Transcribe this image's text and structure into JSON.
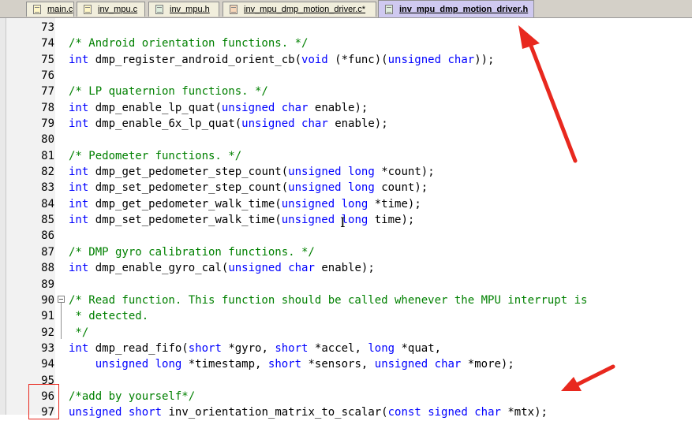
{
  "tabs": [
    {
      "label": "main.c",
      "icon": "c-file-icon",
      "active": false
    },
    {
      "label": "inv_mpu.c",
      "icon": "c-file-icon",
      "active": false
    },
    {
      "label": "inv_mpu.h",
      "icon": "h-file-icon",
      "active": false
    },
    {
      "label": "inv_mpu_dmp_motion_driver.c*",
      "icon": "c-file-modified-icon",
      "active": false
    },
    {
      "label": "inv_mpu_dmp_motion_driver.h",
      "icon": "h-file-icon",
      "active": true
    }
  ],
  "code_lines": [
    {
      "n": "73",
      "segs": []
    },
    {
      "n": "74",
      "segs": [
        {
          "t": "/* Android orientation functions. */",
          "c": "cm"
        }
      ]
    },
    {
      "n": "75",
      "segs": [
        {
          "t": "int",
          "c": "kw"
        },
        {
          "t": " dmp_register_android_orient_cb(",
          "c": ""
        },
        {
          "t": "void",
          "c": "kw"
        },
        {
          "t": " (*func)(",
          "c": ""
        },
        {
          "t": "unsigned",
          "c": "kw"
        },
        {
          "t": " ",
          "c": ""
        },
        {
          "t": "char",
          "c": "kw"
        },
        {
          "t": "));",
          "c": ""
        }
      ]
    },
    {
      "n": "76",
      "segs": []
    },
    {
      "n": "77",
      "segs": [
        {
          "t": "/* LP quaternion functions. */",
          "c": "cm"
        }
      ]
    },
    {
      "n": "78",
      "segs": [
        {
          "t": "int",
          "c": "kw"
        },
        {
          "t": " dmp_enable_lp_quat(",
          "c": ""
        },
        {
          "t": "unsigned",
          "c": "kw"
        },
        {
          "t": " ",
          "c": ""
        },
        {
          "t": "char",
          "c": "kw"
        },
        {
          "t": " enable);",
          "c": ""
        }
      ]
    },
    {
      "n": "79",
      "segs": [
        {
          "t": "int",
          "c": "kw"
        },
        {
          "t": " dmp_enable_6x_lp_quat(",
          "c": ""
        },
        {
          "t": "unsigned",
          "c": "kw"
        },
        {
          "t": " ",
          "c": ""
        },
        {
          "t": "char",
          "c": "kw"
        },
        {
          "t": " enable);",
          "c": ""
        }
      ]
    },
    {
      "n": "80",
      "segs": []
    },
    {
      "n": "81",
      "segs": [
        {
          "t": "/* Pedometer functions. */",
          "c": "cm"
        }
      ]
    },
    {
      "n": "82",
      "segs": [
        {
          "t": "int",
          "c": "kw"
        },
        {
          "t": " dmp_get_pedometer_step_count(",
          "c": ""
        },
        {
          "t": "unsigned",
          "c": "kw"
        },
        {
          "t": " ",
          "c": ""
        },
        {
          "t": "long",
          "c": "kw"
        },
        {
          "t": " *count);",
          "c": ""
        }
      ]
    },
    {
      "n": "83",
      "segs": [
        {
          "t": "int",
          "c": "kw"
        },
        {
          "t": " dmp_set_pedometer_step_count(",
          "c": ""
        },
        {
          "t": "unsigned",
          "c": "kw"
        },
        {
          "t": " ",
          "c": ""
        },
        {
          "t": "long",
          "c": "kw"
        },
        {
          "t": " count);",
          "c": ""
        }
      ]
    },
    {
      "n": "84",
      "segs": [
        {
          "t": "int",
          "c": "kw"
        },
        {
          "t": " dmp_get_pedometer_walk_time(",
          "c": ""
        },
        {
          "t": "unsigned",
          "c": "kw"
        },
        {
          "t": " ",
          "c": ""
        },
        {
          "t": "long",
          "c": "kw"
        },
        {
          "t": " *time);",
          "c": ""
        }
      ]
    },
    {
      "n": "85",
      "segs": [
        {
          "t": "int",
          "c": "kw"
        },
        {
          "t": " dmp_set_pedometer_walk_time(",
          "c": ""
        },
        {
          "t": "unsigned",
          "c": "kw"
        },
        {
          "t": " ",
          "c": ""
        },
        {
          "t": "long",
          "c": "kw"
        },
        {
          "t": " time);",
          "c": ""
        }
      ]
    },
    {
      "n": "86",
      "segs": []
    },
    {
      "n": "87",
      "segs": [
        {
          "t": "/* DMP gyro calibration functions. */",
          "c": "cm"
        }
      ]
    },
    {
      "n": "88",
      "segs": [
        {
          "t": "int",
          "c": "kw"
        },
        {
          "t": " dmp_enable_gyro_cal(",
          "c": ""
        },
        {
          "t": "unsigned",
          "c": "kw"
        },
        {
          "t": " ",
          "c": ""
        },
        {
          "t": "char",
          "c": "kw"
        },
        {
          "t": " enable);",
          "c": ""
        }
      ]
    },
    {
      "n": "89",
      "segs": []
    },
    {
      "n": "90",
      "fold": "start",
      "segs": [
        {
          "t": "/* Read function. This function should be called whenever the MPU interrupt is",
          "c": "cm"
        }
      ]
    },
    {
      "n": "91",
      "fold": "mid",
      "segs": [
        {
          "t": " * detected.",
          "c": "cm"
        }
      ]
    },
    {
      "n": "92",
      "fold": "end",
      "segs": [
        {
          "t": " */",
          "c": "cm"
        }
      ]
    },
    {
      "n": "93",
      "segs": [
        {
          "t": "int",
          "c": "kw"
        },
        {
          "t": " dmp_read_fifo(",
          "c": ""
        },
        {
          "t": "short",
          "c": "kw"
        },
        {
          "t": " *gyro, ",
          "c": ""
        },
        {
          "t": "short",
          "c": "kw"
        },
        {
          "t": " *accel, ",
          "c": ""
        },
        {
          "t": "long",
          "c": "kw"
        },
        {
          "t": " *quat,",
          "c": ""
        }
      ]
    },
    {
      "n": "94",
      "segs": [
        {
          "t": "    ",
          "c": ""
        },
        {
          "t": "unsigned",
          "c": "kw"
        },
        {
          "t": " ",
          "c": ""
        },
        {
          "t": "long",
          "c": "kw"
        },
        {
          "t": " *timestamp, ",
          "c": ""
        },
        {
          "t": "short",
          "c": "kw"
        },
        {
          "t": " *sensors, ",
          "c": ""
        },
        {
          "t": "unsigned",
          "c": "kw"
        },
        {
          "t": " ",
          "c": ""
        },
        {
          "t": "char",
          "c": "kw"
        },
        {
          "t": " *more);",
          "c": ""
        }
      ]
    },
    {
      "n": "95",
      "segs": []
    },
    {
      "n": "96",
      "segs": [
        {
          "t": "/*add by yourself*/",
          "c": "cm"
        }
      ]
    },
    {
      "n": "97",
      "segs": [
        {
          "t": "unsigned",
          "c": "kw"
        },
        {
          "t": " ",
          "c": ""
        },
        {
          "t": "short",
          "c": "kw"
        },
        {
          "t": " inv_orientation_matrix_to_scalar(",
          "c": ""
        },
        {
          "t": "const",
          "c": "kw"
        },
        {
          "t": " ",
          "c": ""
        },
        {
          "t": "signed",
          "c": "kw"
        },
        {
          "t": " ",
          "c": ""
        },
        {
          "t": "char",
          "c": "kw"
        },
        {
          "t": " *mtx);",
          "c": ""
        }
      ]
    }
  ],
  "annotations": {
    "highlight_color": "#e8281e",
    "arrow_to_active_tab": "red-arrow",
    "arrow_to_added_code": "red-arrow"
  },
  "colors": {
    "keyword": "#0000ff",
    "comment": "#008000",
    "active_tab": "#cfc9f0",
    "inactive_tab": "#f1eedc"
  }
}
